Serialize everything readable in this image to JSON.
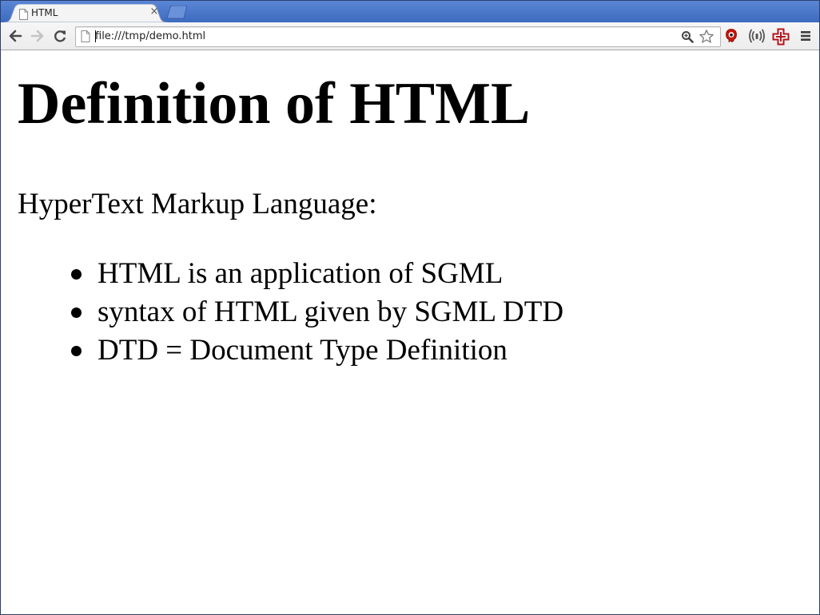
{
  "browser": {
    "tab": {
      "title": "HTML",
      "close_glyph": "×",
      "favicon": "page-icon"
    },
    "new_tab": "new-tab-icon",
    "nav": {
      "back": "arrow-left-icon",
      "forward": "arrow-right-icon",
      "reload": "reload-icon"
    },
    "omnibox": {
      "url": "file:///tmp/demo.html",
      "page_icon": "page-icon",
      "zoom_icon": "magnifier-icon",
      "star_icon": "star-icon"
    },
    "extensions": [
      "red-mascot-icon",
      "wifi-signal-icon",
      "red-cross-icon"
    ],
    "menu_icon": "hamburger-menu-icon",
    "colors": {
      "tabstrip": "#4a76c9",
      "toolbar": "#efefef",
      "mascot": "#c8140a",
      "cross": "#b3131b"
    }
  },
  "page": {
    "title": "Definition of HTML",
    "intro": "HyperText Markup Language:",
    "bullets": [
      "HTML is an application of SGML",
      "syntax of HTML given by SGML DTD",
      "DTD = Document Type Definition"
    ]
  }
}
